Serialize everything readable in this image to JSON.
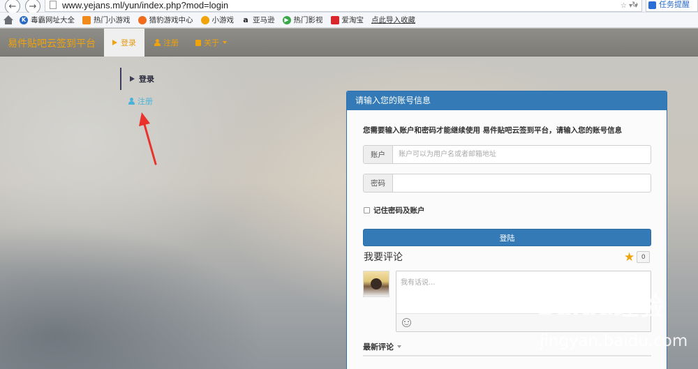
{
  "browser": {
    "url": "www.yejans.ml/yun/index.php?mod=login",
    "search_text": "任务提醒",
    "bookmarks": [
      {
        "label": "毒霸网址大全",
        "icon": "k-circle-icon",
        "color": "#2a6ac7"
      },
      {
        "label": "热门小游戏",
        "icon": "game-icon",
        "color": "#f08a1c"
      },
      {
        "label": "猎豹游戏中心",
        "icon": "cheetah-icon",
        "color": "#f06b1c"
      },
      {
        "label": "小游戏",
        "icon": "game-icon",
        "color": "#f0a30a"
      },
      {
        "label": "亚马逊",
        "icon": "amazon-icon",
        "color": "#222222"
      },
      {
        "label": "热门影视",
        "icon": "play-icon",
        "color": "#3aa84a"
      },
      {
        "label": "爱淘宝",
        "icon": "taobao-icon",
        "color": "#d9262c"
      },
      {
        "label": "点此导入收藏",
        "icon": "",
        "color": ""
      }
    ]
  },
  "navbar": {
    "brand": "易件贴吧云签到平台",
    "login": "登录",
    "register": "注册",
    "about": "关于"
  },
  "sidebar": {
    "login": "登录",
    "register": "注册"
  },
  "panel": {
    "title": "请输入您的账号信息",
    "description": "您需要输入账户和密码才能继续使用 易件贴吧云签到平台，请输入您的账号信息",
    "account_label": "账户",
    "account_placeholder": "账户可以为用户名或者邮箱地址",
    "password_label": "密码",
    "password_placeholder": "",
    "remember_label": "记住密码及账户",
    "login_button": "登陆"
  },
  "comments": {
    "title": "我要评论",
    "count": "0",
    "placeholder": "我有话说...",
    "latest": "最新评论"
  },
  "watermark": {
    "logo": "Baidu经验",
    "url": "jingyan.baidu.com"
  },
  "colors": {
    "accent": "#337ab7",
    "brand": "#f0a30a",
    "annotation": "#e8322b"
  }
}
